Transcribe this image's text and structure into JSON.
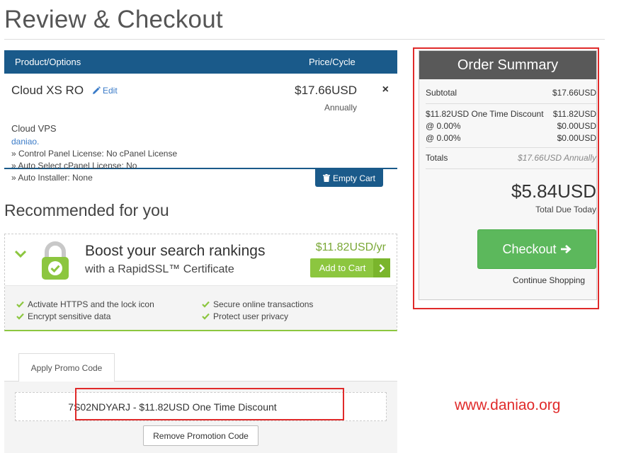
{
  "page": {
    "title": "Review & Checkout",
    "recommended_title": "Recommended for you",
    "watermark": "www.daniao.org"
  },
  "cart": {
    "header_product": "Product/Options",
    "header_price": "Price/Cycle",
    "product_name": "Cloud XS RO",
    "edit_label": "Edit",
    "group": "Cloud VPS",
    "domain": "daniao.",
    "options": [
      "» Control Panel License: No cPanel License",
      "» Auto Select cPanel License: No",
      "» Auto Installer: None"
    ],
    "price": "$17.66USD",
    "cycle": "Annually",
    "remove_symbol": "×",
    "empty_cart_label": "Empty Cart"
  },
  "recommendation": {
    "headline": "Boost your search rankings",
    "subline": "with a RapidSSL™ Certificate",
    "price": "$11.82USD/yr",
    "add_label": "Add to Cart",
    "features": [
      "Activate HTTPS and the lock icon",
      "Secure online transactions",
      "Encrypt sensitive data",
      "Protect user privacy"
    ]
  },
  "promo": {
    "tab_label": "Apply Promo Code",
    "applied_text": "7S02NDYARJ - $11.82USD One Time Discount",
    "remove_label": "Remove Promotion Code"
  },
  "summary": {
    "title": "Order Summary",
    "subtotal_label": "Subtotal",
    "subtotal_value": "$17.66USD",
    "discount_label": "$11.82USD One Time Discount",
    "discount_value": "$11.82USD",
    "tax1_label": "@ 0.00%",
    "tax1_value": "$0.00USD",
    "tax2_label": "@ 0.00%",
    "tax2_value": "$0.00USD",
    "totals_label": "Totals",
    "totals_value": "$17.66USD Annually",
    "total_due": "$5.84USD",
    "total_due_label": "Total Due Today",
    "checkout_label": "Checkout",
    "continue_label": "Continue Shopping"
  },
  "colors": {
    "header_blue": "#1a5a8a",
    "accent_green": "#8cc63f",
    "checkout_green": "#5cb85c",
    "summary_header": "#595959",
    "highlight_red": "#e02a2a"
  },
  "icons": [
    "pencil-icon",
    "close-icon",
    "trash-icon",
    "chevron-down-icon",
    "lock-icon",
    "chevron-right-icon",
    "check-icon",
    "arrow-right-icon"
  ]
}
